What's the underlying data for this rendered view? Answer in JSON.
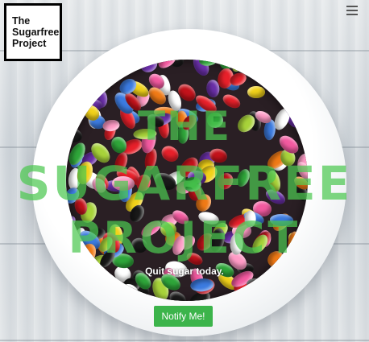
{
  "logo": {
    "line1": "The",
    "line2": "Sugarfree",
    "line3": "Project"
  },
  "nav": {
    "menu_icon": "hamburger-menu-icon"
  },
  "hero": {
    "title_line1": "The",
    "title_line2": "Sugarfree",
    "title_line3": "Project",
    "tagline": "Quit sugar today.",
    "cta_label": "Notify Me!"
  },
  "colors": {
    "accent": "#3cb44b",
    "title_overlay": "#4cc850"
  }
}
